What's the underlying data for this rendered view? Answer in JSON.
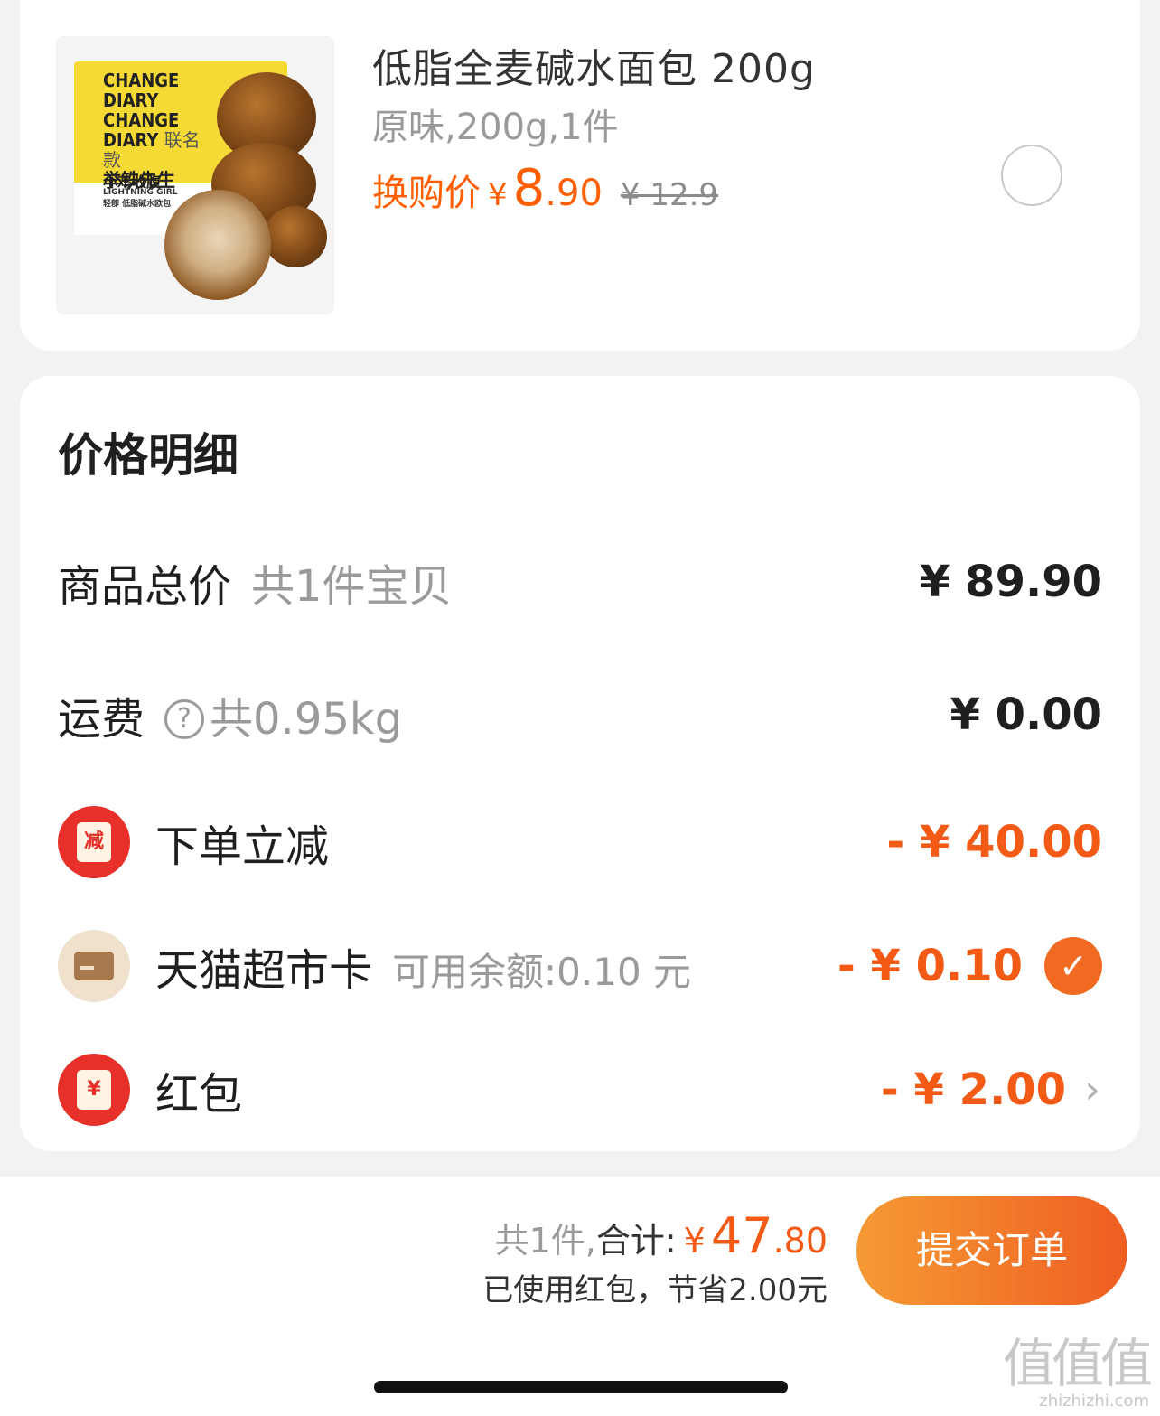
{
  "product": {
    "image_alt": "low-fat whole wheat pretzel bread package",
    "thumb_brand_line1": "CHANGE",
    "thumb_brand_line2": "DIARY",
    "thumb_brand_b1": "CHANGE",
    "thumb_brand_b2": "DIARY",
    "thumb_collab": "联名款",
    "thumb_partner": "举铁先生",
    "thumb_sub": "小鸡收腹",
    "thumb_sub_en": "LIGHTNING GIRL",
    "thumb_sub_small": "轻卽 低脂碱水欧包",
    "title": "低脂全麦碱水面包 200g",
    "spec": "原味,200g,1件",
    "price_label": "换购价",
    "price_yen": "¥",
    "price_int": "8",
    "price_dec": ".90",
    "original_price": "¥ 12.9"
  },
  "detail": {
    "title": "价格明细",
    "rows": [
      {
        "label": "商品总价",
        "sub": "共1件宝贝",
        "value": "¥ 89.90"
      },
      {
        "label": "运费",
        "help": "?",
        "sub": "共0.95kg",
        "value": "¥ 0.00"
      },
      {
        "label": "下单立减",
        "icon_text": "减",
        "value": "- ¥ 40.00"
      },
      {
        "label": "天猫超市卡",
        "sub": "可用余额:0.10 元",
        "value": "- ¥ 0.10",
        "check": "✓"
      },
      {
        "label": "红包",
        "icon_text": "¥",
        "value": "- ¥ 2.00",
        "chevron": "›"
      }
    ]
  },
  "footer": {
    "count": "共1件,",
    "total_label": "合计:",
    "total_yen": "¥",
    "total_int": "47",
    "total_dec": ".80",
    "saving": "已使用红包，节省2.00元",
    "submit": "提交订单"
  },
  "watermark": {
    "main": "值值值",
    "url": "zhizhizhi.com"
  },
  "colors": {
    "accent": "#f35a16",
    "button_from": "#f59a34",
    "button_to": "#ef5e22",
    "discount_red": "#e8302a"
  },
  "icons": [
    "help-circle-icon",
    "discount-tag-icon",
    "gift-card-icon",
    "check-icon",
    "red-packet-icon",
    "chevron-right-icon"
  ]
}
